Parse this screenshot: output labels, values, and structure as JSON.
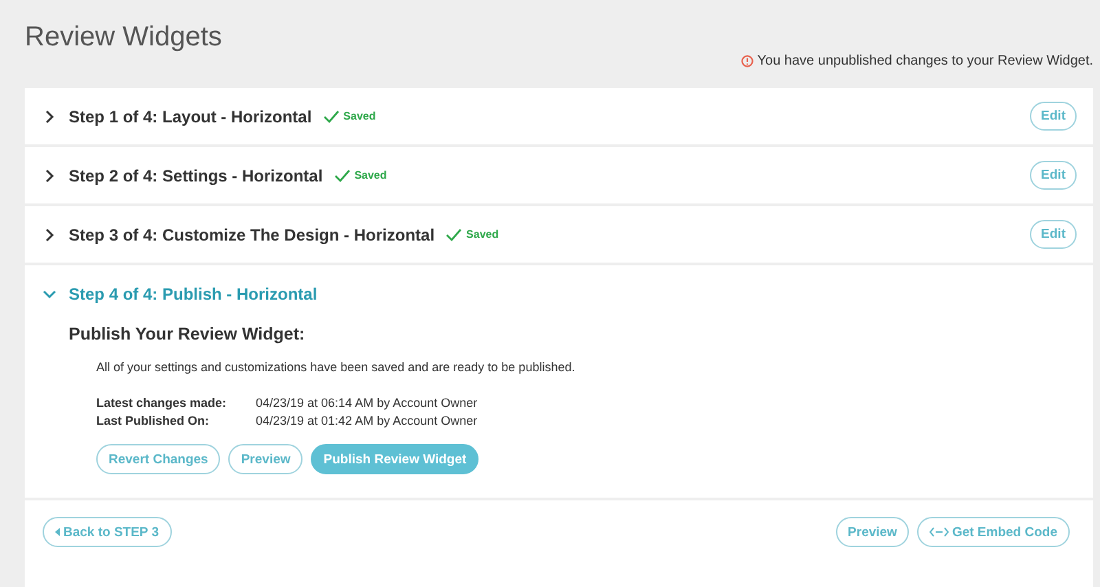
{
  "page": {
    "title": "Review Widgets"
  },
  "warning": {
    "text": "You have unpublished changes to your Review Widget."
  },
  "steps": [
    {
      "title": "Step 1 of 4: Layout - Horizontal",
      "saved": true,
      "status": "Saved",
      "expanded": false,
      "action": "Edit"
    },
    {
      "title": "Step 2 of 4: Settings - Horizontal",
      "saved": true,
      "status": "Saved",
      "expanded": false,
      "action": "Edit"
    },
    {
      "title": "Step 3 of 4: Customize The Design - Horizontal",
      "saved": true,
      "status": "Saved",
      "expanded": false,
      "action": "Edit"
    },
    {
      "title": "Step 4 of 4: Publish - Horizontal",
      "saved": false,
      "expanded": true
    }
  ],
  "publish": {
    "heading": "Publish Your Review Widget:",
    "message": "All of your settings and customizations have been saved and are ready to be published.",
    "details": [
      {
        "label": "Latest changes made:",
        "value": "04/23/19 at 06:14 AM by Account Owner"
      },
      {
        "label": "Last Published On:",
        "value": "04/23/19 at 01:42 AM by Account Owner"
      }
    ],
    "buttons": [
      {
        "label": "Revert Changes",
        "kind": "outline"
      },
      {
        "label": "Preview",
        "kind": "outline"
      },
      {
        "label": "Publish Review Widget",
        "kind": "primary"
      }
    ]
  },
  "footer": {
    "back": "Back to STEP 3",
    "preview": "Preview",
    "embed": "Get Embed Code"
  }
}
